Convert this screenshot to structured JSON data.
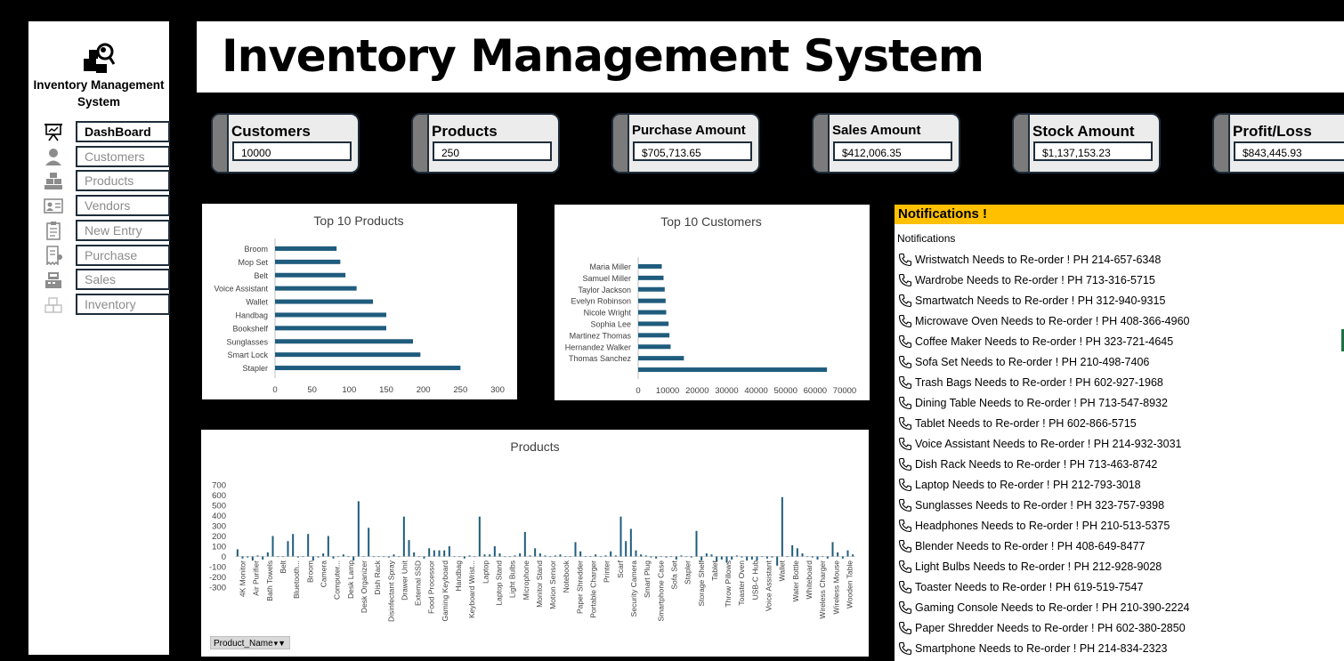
{
  "app": {
    "sidebar_title": "Inventory Management System",
    "page_title": "Inventory Management System"
  },
  "sidebar": {
    "items": [
      {
        "label": "DashBoard",
        "icon": "presentation-icon",
        "active": true
      },
      {
        "label": "Customers",
        "icon": "person-icon",
        "active": false
      },
      {
        "label": "Products",
        "icon": "boxes-icon",
        "active": false
      },
      {
        "label": "Vendors",
        "icon": "contact-card-icon",
        "active": false
      },
      {
        "label": "New Entry",
        "icon": "clipboard-icon",
        "active": false
      },
      {
        "label": "Purchase",
        "icon": "receipt-icon",
        "active": false
      },
      {
        "label": "Sales",
        "icon": "cash-register-icon",
        "active": false
      },
      {
        "label": "Inventory",
        "icon": "stacked-boxes-icon",
        "active": false
      }
    ]
  },
  "kpis": [
    {
      "label": "Customers",
      "value": "10000"
    },
    {
      "label": "Products",
      "value": "250"
    },
    {
      "label": "Purchase Amount",
      "value": "$705,713.65"
    },
    {
      "label": "Sales Amount",
      "value": "$412,006.35"
    },
    {
      "label": "Stock Amount",
      "value": "$1,137,153.23"
    },
    {
      "label": "Profit/Loss",
      "value": "$843,445.93"
    }
  ],
  "colors": {
    "bar": "#1f5c7d",
    "notification_header": "#ffc000",
    "card_stripe": "#7b7b7b",
    "card_border": "#1f2d3a"
  },
  "chart_data": [
    {
      "type": "bar",
      "orientation": "horizontal",
      "title": "Top 10 Products",
      "categories": [
        "Broom",
        "Mop Set",
        "Belt",
        "Voice Assistant",
        "Wallet",
        "Handbag",
        "Bookshelf",
        "Sunglasses",
        "Smart Lock",
        "Stapler"
      ],
      "values": [
        83,
        88,
        95,
        110,
        132,
        150,
        150,
        186,
        196,
        250
      ],
      "xlim": [
        0,
        300
      ],
      "xticks": [
        0,
        50,
        100,
        150,
        200,
        250,
        300
      ]
    },
    {
      "type": "bar",
      "orientation": "horizontal",
      "title": "Top 10 Customers",
      "categories": [
        "Maria Miller",
        "Samuel Miller",
        "Taylor Jackson",
        "Evelyn Robinson",
        "Nicole Wright",
        "Sophia Lee",
        "Martinez Thomas",
        "Hernandez Walker",
        "Thomas Sanchez",
        ""
      ],
      "values": [
        8000,
        8600,
        9000,
        9300,
        9500,
        10300,
        10600,
        11000,
        15500,
        64000
      ],
      "xlim": [
        0,
        70000
      ],
      "xticks": [
        0,
        10000,
        20000,
        30000,
        40000,
        50000,
        60000,
        70000
      ]
    },
    {
      "type": "bar",
      "title": "Products",
      "ylim": [
        -300,
        700
      ],
      "yticks": [
        700,
        600,
        500,
        400,
        300,
        200,
        100,
        0,
        -100,
        -200,
        -300
      ],
      "category_labels": [
        "4K Monitor",
        "Air Purifier",
        "Bath Towels",
        "Belt",
        "Bluetooth...",
        "Broom",
        "Camera",
        "Computer...",
        "Desk Lamp",
        "Desk Organizer",
        "Dish Rack",
        "Disinfectant Spray",
        "Drawer Unit",
        "External SSD",
        "Food Processor",
        "Gaming Keyboard",
        "Handbag",
        "Keyboard Wrist...",
        "Laptop",
        "Laptop Stand",
        "Light Bulbs",
        "Microphone",
        "Monitor Stand",
        "Motion Sensor",
        "Notebook",
        "Paper Shredder",
        "Portable Charger",
        "Printer",
        "Scarf",
        "Security Camera",
        "Smart Plug",
        "Smartphone Case",
        "Sofa Set",
        "Stapler",
        "Storage Shelf",
        "Tablet",
        "Throw Pillows",
        "Toaster Oven",
        "USB-C Hub",
        "Voice Assistant",
        "Wallet",
        "Water Bottle",
        "Whiteboard",
        "Wireless Charger",
        "Wireless Mouse",
        "Wooden Table"
      ],
      "values": [
        70,
        -20,
        -10,
        -40,
        10,
        -30,
        40,
        200,
        0,
        0,
        150,
        220,
        -10,
        0,
        220,
        -40,
        -10,
        30,
        200,
        -20,
        0,
        20,
        0,
        -40,
        540,
        0,
        280,
        0,
        0,
        0,
        -10,
        20,
        0,
        390,
        160,
        40,
        0,
        -20,
        80,
        60,
        60,
        60,
        100,
        0,
        0,
        -20,
        10,
        0,
        390,
        20,
        20,
        100,
        30,
        0,
        0,
        10,
        30,
        240,
        10,
        80,
        30,
        10,
        0,
        10,
        20,
        0,
        0,
        140,
        50,
        0,
        0,
        20,
        0,
        10,
        50,
        10,
        390,
        150,
        270,
        60,
        20,
        10,
        -10,
        -20,
        0,
        -10,
        0,
        -30,
        10,
        0,
        -10,
        250,
        -40,
        30,
        20,
        -50,
        -30,
        -60,
        -30,
        10,
        -10,
        -40,
        -30,
        -40,
        0,
        -20,
        -10,
        -90,
        580,
        0,
        110,
        80,
        30,
        0,
        -10,
        -30,
        0,
        -20,
        140,
        40,
        -20,
        60,
        20
      ],
      "filter_button": "Product_Name"
    }
  ],
  "notifications": {
    "header": "Notifications !",
    "subheader": "Notifications",
    "icon": "phone-icon",
    "items": [
      "Wristwatch Needs to Re-order ! PH 214-657-6348",
      "Wardrobe Needs to Re-order ! PH 713-316-5715",
      "Smartwatch Needs to Re-order ! PH 312-940-9315",
      "Microwave Oven Needs to Re-order ! PH 408-366-4960",
      "Coffee Maker Needs to Re-order ! PH 323-721-4645",
      "Sofa Set Needs to Re-order ! PH 210-498-7406",
      "Trash Bags Needs to Re-order ! PH 602-927-1968",
      "Dining Table Needs to Re-order ! PH 713-547-8932",
      "Tablet Needs to Re-order ! PH 602-866-5715",
      "Voice Assistant Needs to Re-order ! PH 214-932-3031",
      "Dish Rack Needs to Re-order ! PH 713-463-8742",
      "Laptop Needs to Re-order ! PH 212-793-3018",
      "Sunglasses Needs to Re-order ! PH 323-757-9398",
      "Headphones Needs to Re-order ! PH 210-513-5375",
      "Blender Needs to Re-order ! PH 408-649-8477",
      "Light Bulbs Needs to Re-order ! PH 212-928-9028",
      "Toaster Needs to Re-order ! PH 619-519-7547",
      "Gaming Console Needs to Re-order ! PH 210-390-2224",
      "Paper Shredder Needs to Re-order ! PH 602-380-2850",
      "Smartphone Needs to Re-order ! PH 214-834-2323"
    ]
  }
}
